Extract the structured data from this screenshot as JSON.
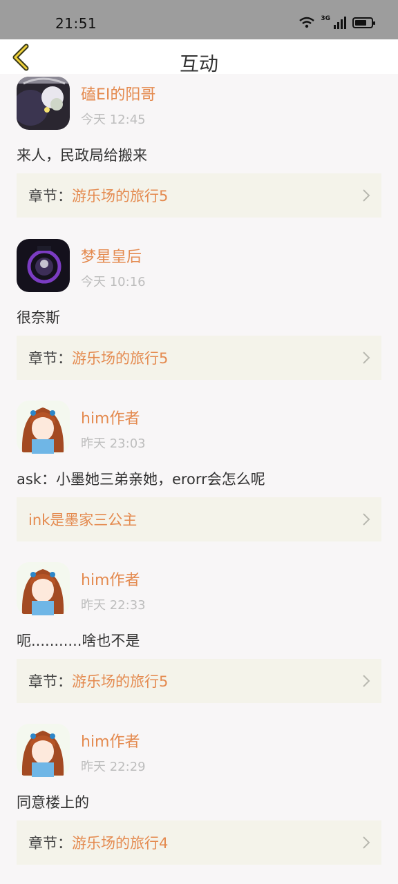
{
  "status_bar": {
    "time": "21:51",
    "network": "3G"
  },
  "nav": {
    "title": "互动"
  },
  "items": [
    {
      "username": "磕EI的阳哥",
      "time": "今天 12:45",
      "content": "来人，民政局给搬来",
      "card_prefix": "章节：",
      "card_target": "游乐场的旅行5"
    },
    {
      "username": "梦星皇后",
      "time": "今天 10:16",
      "content": "很奈斯",
      "card_prefix": "章节：",
      "card_target": "游乐场的旅行5"
    },
    {
      "username": "him作者",
      "time": "昨天 23:03",
      "content": "ask：小墨她三弟亲她，erorr会怎么呢",
      "card_prefix": "",
      "card_target": "ink是墨家三公主"
    },
    {
      "username": "him作者",
      "time": "昨天 22:33",
      "content": "呃...........啥也不是",
      "card_prefix": "章节：",
      "card_target": "游乐场的旅行5"
    },
    {
      "username": "him作者",
      "time": "昨天 22:29",
      "content": "同意楼上的",
      "card_prefix": "章节：",
      "card_target": "游乐场的旅行4"
    }
  ]
}
